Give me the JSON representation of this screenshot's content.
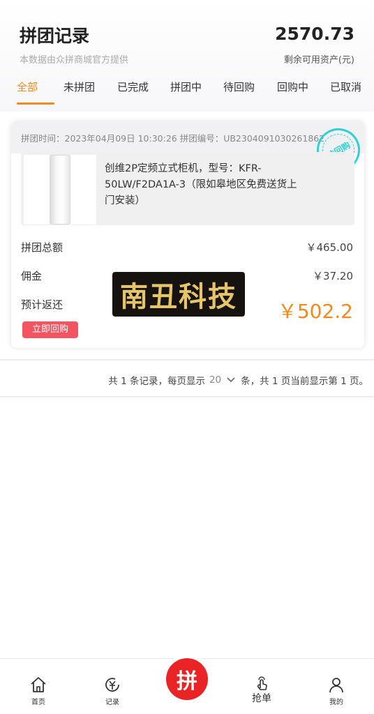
{
  "header": {
    "title": "拼团记录",
    "subtitle": "本数据由众拼商城官方提供",
    "balance": "2570.73",
    "balance_label": "剩余可用资产(元)"
  },
  "tabs": [
    {
      "label": "全部",
      "active": true
    },
    {
      "label": "未拼团",
      "active": false
    },
    {
      "label": "已完成",
      "active": false
    },
    {
      "label": "拼团中",
      "active": false
    },
    {
      "label": "待回购",
      "active": false
    },
    {
      "label": "回购中",
      "active": false
    },
    {
      "label": "已取消",
      "active": false
    }
  ],
  "order": {
    "meta": "拼团时间：2023年04月09日 10:30:26 拼团编号：UB2304091030261862",
    "stamp": "待回购",
    "product_name": "创维2P定频立式柜机，型号：KFR-50LW/F2DA1A-3（限如皋地区免费送货上门安装）",
    "total_label": "拼团总额",
    "total_value": "￥465.00",
    "commission_label": "佣金",
    "commission_value": "￥37.20",
    "expected_label": "预计返还",
    "expected_value": "￥502.2",
    "rebuy_button": "立即回购"
  },
  "watermark": {
    "text": "南丑科技"
  },
  "pager": {
    "prefix": "共 1 条记录，每页显示",
    "page_size": "20",
    "suffix": "条，共 1 页当前显示第 1 页。"
  },
  "bottom_nav": {
    "home": "首页",
    "records": "记录",
    "center": "拼",
    "grab": "抢单",
    "mine": "我的"
  },
  "colors": {
    "accent": "#f08a1e",
    "button_red": "#f25461",
    "center_red": "#ea2424",
    "stamp_cyan": "#31d0d6"
  }
}
